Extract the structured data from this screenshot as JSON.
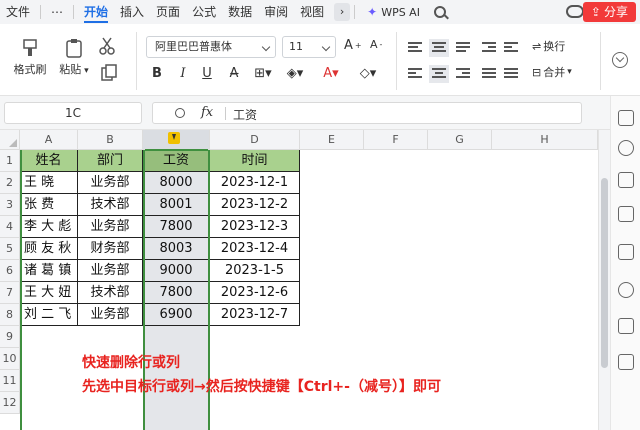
{
  "menu": {
    "items": [
      "文件",
      "开始",
      "插入",
      "页面",
      "公式",
      "数据",
      "审阅",
      "视图"
    ],
    "active_index": 1,
    "more_label": "⋯",
    "next_label": "›",
    "ai_label": "WPS AI",
    "share_label": "分享"
  },
  "ribbon": {
    "format_painter": "格式刷",
    "paste": "粘贴",
    "font_name": "阿里巴巴普惠体",
    "font_size": "11",
    "bold": "B",
    "italic": "I",
    "underline": "U",
    "wrap": "换行",
    "merge": "合并"
  },
  "formula_bar": {
    "name_box": "1C",
    "fx": "fx",
    "value": "工资"
  },
  "columns": [
    "A",
    "B",
    "C",
    "D",
    "E",
    "F",
    "G",
    "H"
  ],
  "selected_column": "C",
  "rows": [
    "1",
    "2",
    "3",
    "4",
    "5",
    "6",
    "7",
    "8",
    "9",
    "10",
    "11",
    "12"
  ],
  "table": {
    "headers": [
      "姓名",
      "部门",
      "工资",
      "时间"
    ],
    "rows": [
      [
        "王    晓",
        "业务部",
        "8000",
        "2023-12-1"
      ],
      [
        "张    费",
        "技术部",
        "8001",
        "2023-12-2"
      ],
      [
        "李 大 彪",
        "业务部",
        "7800",
        "2023-12-3"
      ],
      [
        "顾 友 秋",
        "财务部",
        "8003",
        "2023-12-4"
      ],
      [
        "诸 葛 镇",
        "业务部",
        "9000",
        "2023-1-5"
      ],
      [
        "王 大 妞",
        "技术部",
        "7800",
        "2023-12-6"
      ],
      [
        "刘 二 飞",
        "业务部",
        "6900",
        "2023-12-7"
      ]
    ]
  },
  "notes": {
    "line1": "快速删除行或列",
    "line2": "先选中目标行或列→然后按快捷键【Ctrl+-（减号）】即可"
  },
  "colors": {
    "header_fill": "#a9d18e",
    "accent": "#1f6fe5",
    "note": "#e8231f",
    "selection": "#3f8f3f",
    "share": "#f23a3a"
  }
}
